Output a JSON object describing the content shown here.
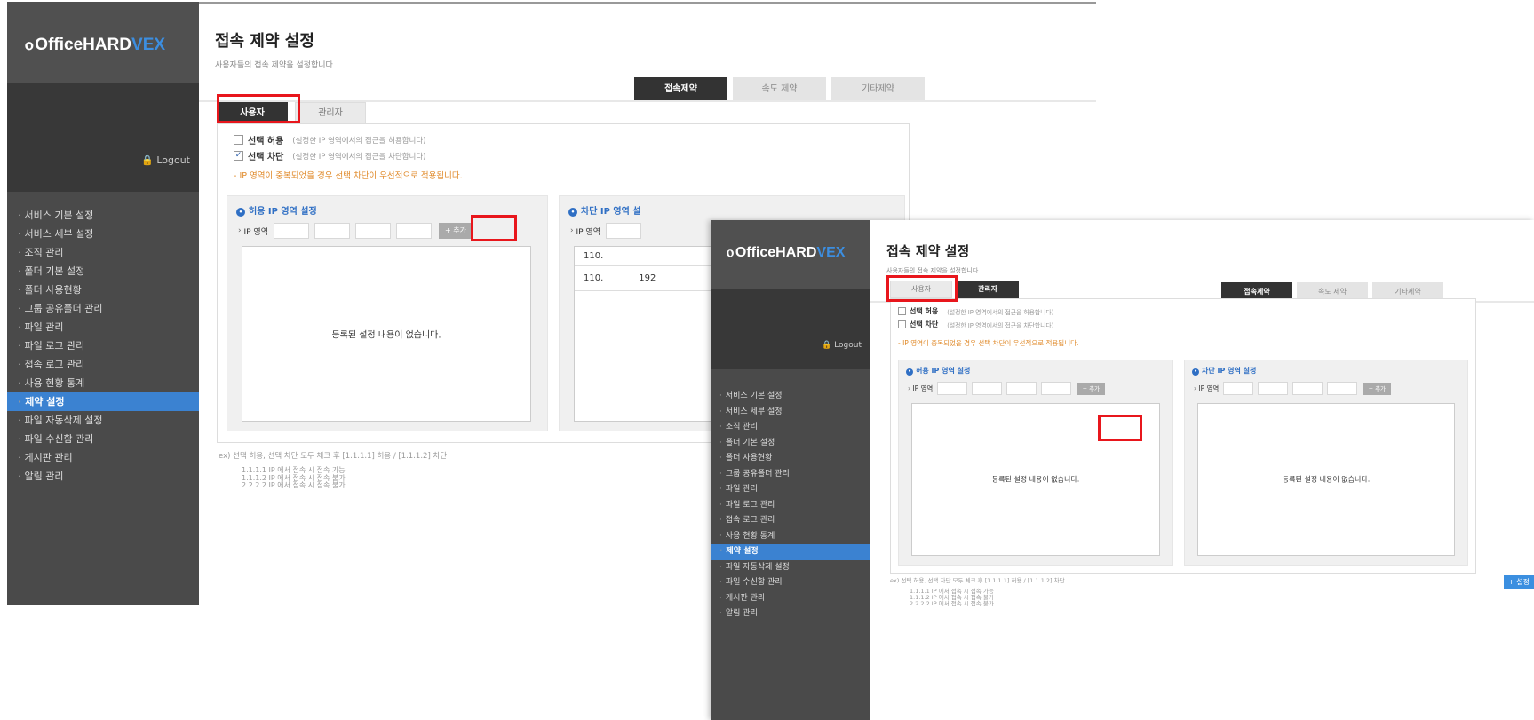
{
  "logo": {
    "mark": "ⲟ",
    "main": "OfficeHARD",
    "accent": "VEX"
  },
  "logout": "Logout",
  "menu": [
    "서비스 기본 설정",
    "서비스 세부 설정",
    "조직 관리",
    "폴더 기본 설정",
    "폴더 사용현황",
    "그룹 공유폴더 관리",
    "파일 관리",
    "파일 로그 관리",
    "접속 로그 관리",
    "사용 현황 통계",
    "제약 설정",
    "파일 자동삭제 설정",
    "파일 수신함 관리",
    "게시판 관리",
    "알림 관리"
  ],
  "active_menu_index": 10,
  "page_title": "접속 제약 설정",
  "page_subtitle": "사용자들의 접속 제약을 설정합니다",
  "top_tabs": [
    "접속제약",
    "속도 제약",
    "기타제약"
  ],
  "sub_tabs": [
    "사용자",
    "관리자"
  ],
  "options": {
    "allow": {
      "label": "선택 허용",
      "desc": "(설정한 IP 영역에서의 접근을 허용합니다)"
    },
    "block": {
      "label": "선택 차단",
      "desc": "(설정한 IP 영역에서의 접근을 차단합니다)"
    }
  },
  "warning": "- IP 영역이 중복되었을 경우 선택 차단이 우선적으로 적용됩니다.",
  "allow_box_title": "허용 IP 영역 설정",
  "block_box_title": "차단 IP 영역 설정",
  "block_box_title_partial": "차단 IP 영역 설",
  "ip_label": "IP 영역",
  "add_button": "+ 추가",
  "empty_message": "등록된 설정 내용이 없습니다.",
  "block_list_rows": [
    {
      "a": "110.",
      "b": ""
    },
    {
      "a": "110.",
      "b": "192"
    }
  ],
  "example_line": "ex) 선택 허용, 선택 차단 모두 체크 후 [1.1.1.1] 허용 / [1.1.1.2] 차단",
  "example_details": [
    "1.1.1.1 IP 에서 접속 시 접속 가능",
    "1.1.1.2 IP 에서 접속 시 접속 불가",
    "2.2.2.2 IP 에서 접속 시 접속 불가"
  ],
  "save_button": "+ 설정",
  "colors": {
    "sidebar": "#4a4a4a",
    "active_menu": "#3b82d1",
    "highlight": "#e8161c",
    "warning": "#e08a2a",
    "accent": "#2f6fc4"
  }
}
